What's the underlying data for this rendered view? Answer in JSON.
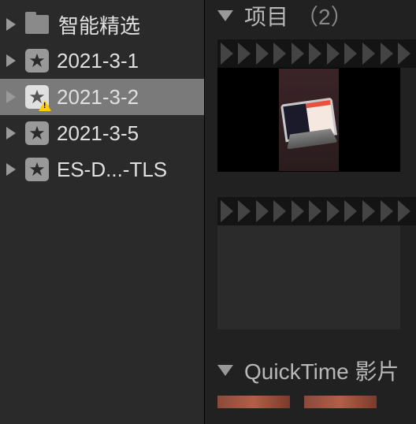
{
  "sidebar": {
    "items": [
      {
        "label": "智能精选",
        "type": "folder",
        "selected": false
      },
      {
        "label": "2021-3-1",
        "type": "event",
        "selected": false
      },
      {
        "label": "2021-3-2",
        "type": "event",
        "selected": true,
        "warning": true
      },
      {
        "label": "2021-3-5",
        "type": "event",
        "selected": false
      },
      {
        "label": "ES-D...-TLS",
        "type": "event",
        "selected": false
      }
    ]
  },
  "content": {
    "section1": {
      "title": "项目",
      "count": "（2）"
    },
    "section2": {
      "title": "QuickTime 影片"
    }
  }
}
